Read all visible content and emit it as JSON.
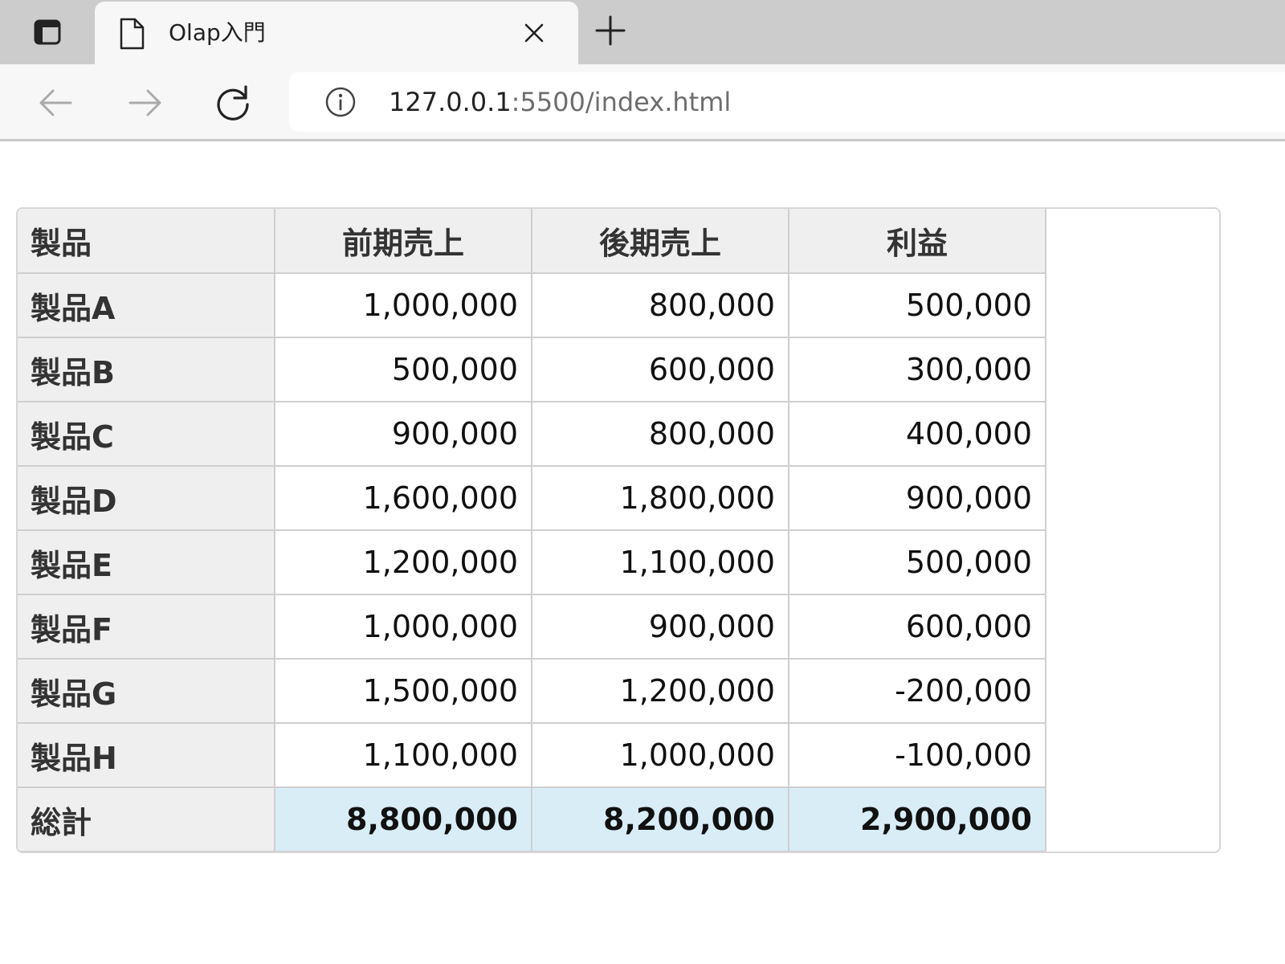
{
  "browser": {
    "tab": {
      "title": "Olap入門"
    },
    "address": {
      "host": "127.0.0.1",
      "rest": ":5500/index.html"
    },
    "icons": {
      "tab_actions": "tab-actions-icon",
      "tab_page": "document-icon",
      "tab_close": "close-icon",
      "new_tab": "plus-icon",
      "back": "arrow-left-icon",
      "forward": "arrow-right-icon",
      "reload": "reload-icon",
      "site_info": "info-icon"
    }
  },
  "table": {
    "headers": [
      "製品",
      "前期売上",
      "後期売上",
      "利益"
    ],
    "rows": [
      {
        "label": "製品A",
        "values": [
          "1,000,000",
          "800,000",
          "500,000"
        ]
      },
      {
        "label": "製品B",
        "values": [
          "500,000",
          "600,000",
          "300,000"
        ]
      },
      {
        "label": "製品C",
        "values": [
          "900,000",
          "800,000",
          "400,000"
        ]
      },
      {
        "label": "製品D",
        "values": [
          "1,600,000",
          "1,800,000",
          "900,000"
        ]
      },
      {
        "label": "製品E",
        "values": [
          "1,200,000",
          "1,100,000",
          "500,000"
        ]
      },
      {
        "label": "製品F",
        "values": [
          "1,000,000",
          "900,000",
          "600,000"
        ]
      },
      {
        "label": "製品G",
        "values": [
          "1,500,000",
          "1,200,000",
          "-200,000"
        ]
      },
      {
        "label": "製品H",
        "values": [
          "1,100,000",
          "1,000,000",
          "-100,000"
        ]
      }
    ],
    "total": {
      "label": "総計",
      "values": [
        "8,800,000",
        "8,200,000",
        "2,900,000"
      ]
    },
    "colors": {
      "header_bg": "#efefef",
      "total_bg": "#d9edf7",
      "border": "#cfcfcf"
    }
  }
}
